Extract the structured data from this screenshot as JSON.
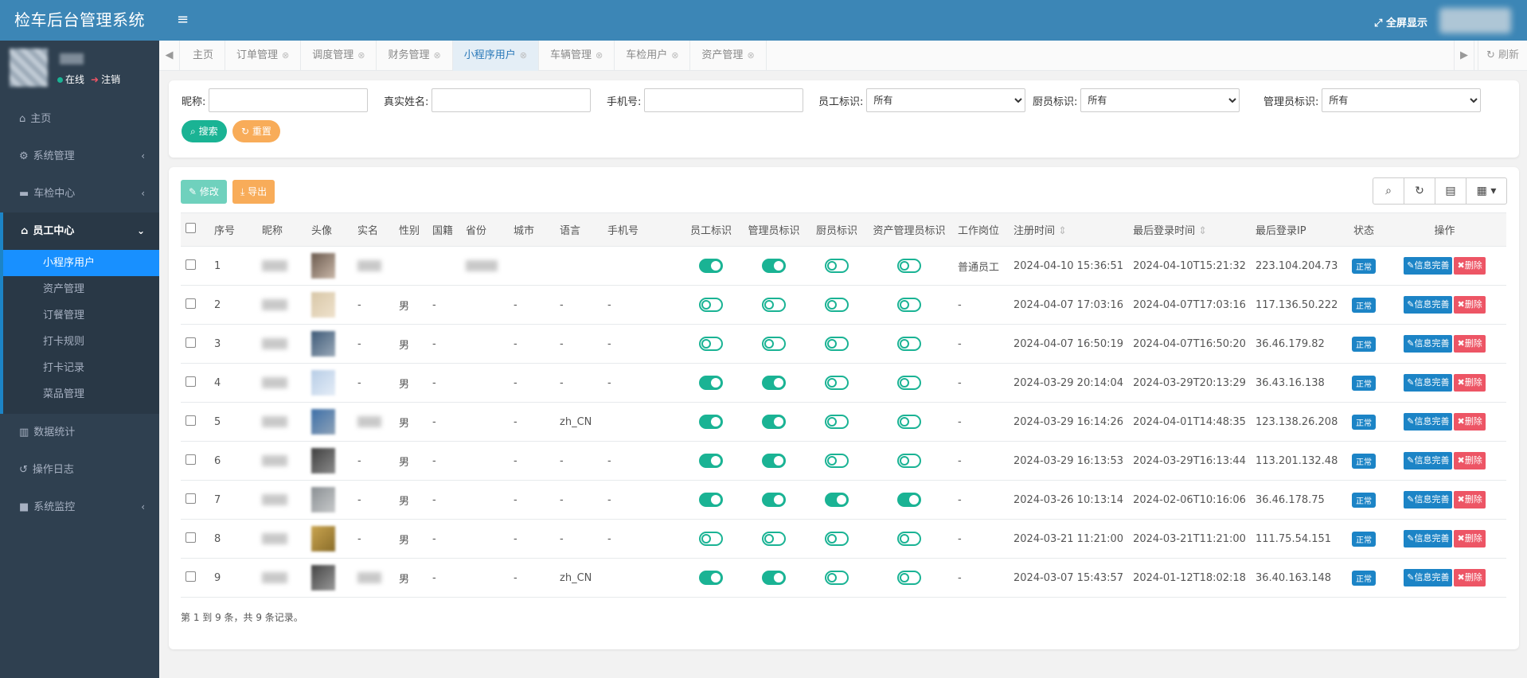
{
  "app_title": "检车后台管理系统",
  "user": {
    "online_label": "在线",
    "logout_label": "注销"
  },
  "sidebar": {
    "items": [
      {
        "label": "主页",
        "icon": "home-icon"
      },
      {
        "label": "系统管理",
        "icon": "gear-icon"
      },
      {
        "label": "车检中心",
        "icon": "car-icon"
      },
      {
        "label": "员工中心",
        "icon": "bank-icon"
      },
      {
        "label": "数据统计",
        "icon": "bar-chart-icon"
      },
      {
        "label": "操作日志",
        "icon": "history-icon"
      },
      {
        "label": "系统监控",
        "icon": "camera-icon"
      }
    ],
    "sub_items": [
      "小程序用户",
      "资产管理",
      "订餐管理",
      "打卡规则",
      "打卡记录",
      "菜品管理"
    ]
  },
  "topbar": {
    "fullscreen_label": "全屏显示"
  },
  "tabs": [
    "主页",
    "订单管理",
    "调度管理",
    "财务管理",
    "小程序用户",
    "车辆管理",
    "车检用户",
    "资产管理"
  ],
  "refresh_label": "刷新",
  "search": {
    "nickname_label": "昵称:",
    "realname_label": "真实姓名:",
    "phone_label": "手机号:",
    "employee_label": "员工标识:",
    "cook_label": "厨员标识:",
    "admin_label": "管理员标识:",
    "select_value": "所有",
    "search_btn": "搜索",
    "reset_btn": "重置"
  },
  "toolbar": {
    "edit_btn": "修改",
    "export_btn": "导出"
  },
  "table": {
    "headers": [
      "序号",
      "昵称",
      "头像",
      "实名",
      "性别",
      "国籍",
      "省份",
      "城市",
      "语言",
      "手机号",
      "员工标识",
      "管理员标识",
      "厨员标识",
      "资产管理员标识",
      "工作岗位",
      "注册时间",
      "最后登录时间",
      "最后登录IP",
      "状态",
      "操作"
    ],
    "rows": [
      {
        "no": "1",
        "gender": "",
        "nation": "",
        "city": "",
        "lang": "",
        "phone": "",
        "post": "普通员工",
        "reg": "2024-04-10 15:36:51",
        "last": "2024-04-10T15:21:32",
        "ip": "223.104.204.73",
        "status": "正常"
      },
      {
        "no": "2",
        "gender": "男",
        "nation": "-",
        "city": "-",
        "lang": "-",
        "phone": "-",
        "post": "-",
        "reg": "2024-04-07 17:03:16",
        "last": "2024-04-07T17:03:16",
        "ip": "117.136.50.222",
        "status": "正常"
      },
      {
        "no": "3",
        "gender": "男",
        "nation": "-",
        "city": "-",
        "lang": "-",
        "phone": "-",
        "post": "-",
        "reg": "2024-04-07 16:50:19",
        "last": "2024-04-07T16:50:20",
        "ip": "36.46.179.82",
        "status": "正常"
      },
      {
        "no": "4",
        "gender": "男",
        "nation": "-",
        "city": "-",
        "lang": "-",
        "phone": "-",
        "post": "-",
        "reg": "2024-03-29 20:14:04",
        "last": "2024-03-29T20:13:29",
        "ip": "36.43.16.138",
        "status": "正常"
      },
      {
        "no": "5",
        "gender": "男",
        "nation": "-",
        "city": "-",
        "lang": "zh_CN",
        "phone": "",
        "post": "-",
        "reg": "2024-03-29 16:14:26",
        "last": "2024-04-01T14:48:35",
        "ip": "123.138.26.208",
        "status": "正常"
      },
      {
        "no": "6",
        "gender": "男",
        "nation": "-",
        "city": "-",
        "lang": "-",
        "phone": "-",
        "post": "-",
        "reg": "2024-03-29 16:13:53",
        "last": "2024-03-29T16:13:44",
        "ip": "113.201.132.48",
        "status": "正常"
      },
      {
        "no": "7",
        "gender": "男",
        "nation": "-",
        "city": "-",
        "lang": "-",
        "phone": "-",
        "post": "-",
        "reg": "2024-03-26 10:13:14",
        "last": "2024-02-06T10:16:06",
        "ip": "36.46.178.75",
        "status": "正常"
      },
      {
        "no": "8",
        "gender": "男",
        "nation": "-",
        "city": "-",
        "lang": "-",
        "phone": "-",
        "post": "-",
        "reg": "2024-03-21 11:21:00",
        "last": "2024-03-21T11:21:00",
        "ip": "111.75.54.151",
        "status": "正常"
      },
      {
        "no": "9",
        "gender": "男",
        "nation": "-",
        "city": "-",
        "lang": "zh_CN",
        "phone": "",
        "post": "-",
        "reg": "2024-03-07 15:43:57",
        "last": "2024-01-12T18:02:18",
        "ip": "36.40.163.148",
        "status": "正常"
      }
    ],
    "switches": [
      [
        true,
        true,
        false,
        false
      ],
      [
        false,
        false,
        false,
        false
      ],
      [
        false,
        false,
        false,
        false
      ],
      [
        true,
        true,
        false,
        false
      ],
      [
        true,
        true,
        false,
        false
      ],
      [
        true,
        true,
        false,
        false
      ],
      [
        true,
        true,
        true,
        true
      ],
      [
        false,
        false,
        false,
        false
      ],
      [
        true,
        true,
        false,
        false
      ]
    ],
    "info_btn": "信息完善",
    "delete_btn": "删除"
  },
  "pager_text": "第 1 到 9 条，共 9 条记录。",
  "colors": {
    "primary": "#3c86b6",
    "sidebar": "#2f4050",
    "success": "#1ab394",
    "danger": "#ed5565",
    "info": "#1c84c6",
    "warning": "#f8ac59"
  }
}
